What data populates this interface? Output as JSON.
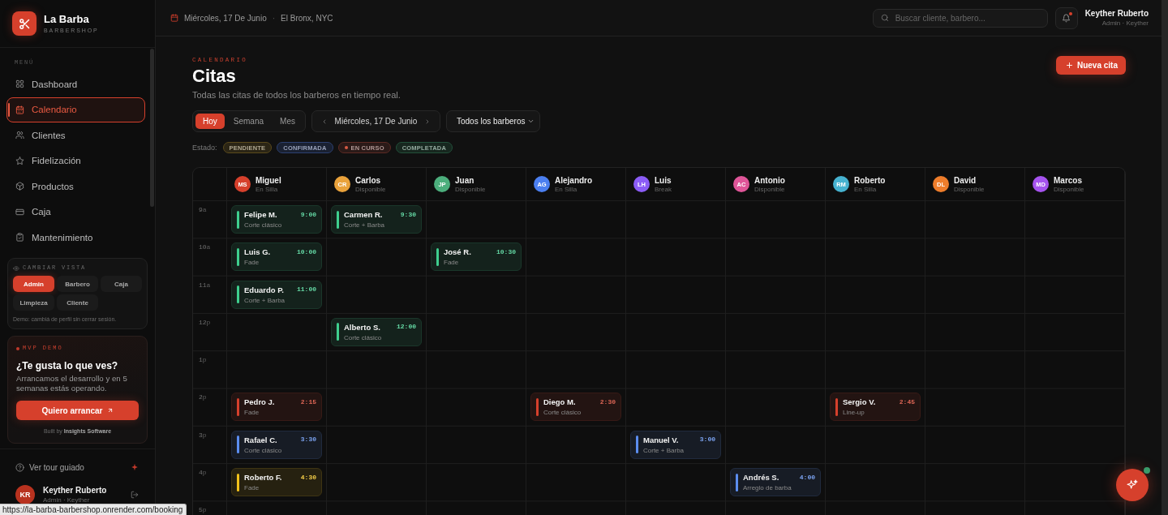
{
  "brand": {
    "name": "La Barba",
    "tagline": "BARBERSHOP"
  },
  "sidebar": {
    "section_label": "MENÚ",
    "items": [
      {
        "label": "Dashboard",
        "selected": false
      },
      {
        "label": "Calendario",
        "selected": true
      },
      {
        "label": "Clientes",
        "selected": false
      },
      {
        "label": "Fidelización",
        "selected": false
      },
      {
        "label": "Productos",
        "selected": false
      },
      {
        "label": "Caja",
        "selected": false
      },
      {
        "label": "Mantenimiento",
        "selected": false
      }
    ]
  },
  "view_switcher": {
    "title": "CAMBIAR VISTA",
    "options": [
      {
        "label": "Admin",
        "selected": true
      },
      {
        "label": "Barbero",
        "selected": false
      },
      {
        "label": "Caja",
        "selected": false
      },
      {
        "label": "Limpieza",
        "selected": false
      },
      {
        "label": "Cliente",
        "selected": false
      }
    ],
    "note": "Demo: cambiá de perfil sin cerrar sesión."
  },
  "promo": {
    "eyebrow": "MVP DEMO",
    "title": "¿Te gusta lo que ves?",
    "text": "Arrancamos el desarrollo y en 5 semanas estás operando.",
    "button": "Quiero arrancar",
    "credit": "Built by **Insights Software**"
  },
  "sidebar_footer": {
    "tour": "Ver tour guiado",
    "user": {
      "initials": "KR",
      "name": "Keyther Ruberto",
      "role": "Admin · Keyther"
    }
  },
  "status_url": "https://la-barba-barbershop.onrender.com/booking",
  "topbar": {
    "date": "Miércoles, 17 De Junio",
    "separator": "·",
    "location": "El Bronx, NYC",
    "search": {
      "placeholder": "Buscar cliente, barbero..."
    },
    "notifications": {
      "unread": true
    },
    "user": {
      "name": "Keyther Ruberto",
      "role": "Admin · Keyther"
    }
  },
  "page": {
    "eyebrow": "CALENDARIO",
    "title": "Citas",
    "subtitle": "Todas las citas de todos los barberos en tiempo real.",
    "new_button": "Nueva cita"
  },
  "controls": {
    "views": [
      {
        "label": "Hoy",
        "selected": true
      },
      {
        "label": "Semana",
        "selected": false
      },
      {
        "label": "Mes",
        "selected": false
      }
    ],
    "date": "Miércoles, 17 De Junio",
    "barber_filter": "Todos los barberos"
  },
  "legend": {
    "label": "Estado:",
    "statuses": [
      {
        "label": "PENDIENTE",
        "color": "#5a4a1c",
        "live": false
      },
      {
        "label": "CONFIRMADA",
        "color": "#2c4070",
        "live": false
      },
      {
        "label": "EN CURSO",
        "color": "#5c2a24",
        "live": true
      },
      {
        "label": "COMPLETADA",
        "color": "#22503a",
        "live": false
      }
    ]
  },
  "schedule": {
    "barbers": [
      {
        "initials": "MS",
        "name": "Miguel",
        "availability": "En Silla",
        "color": "#d6402c"
      },
      {
        "initials": "CR",
        "name": "Carlos",
        "availability": "Disponible",
        "color": "#e9a23b"
      },
      {
        "initials": "JP",
        "name": "Juan",
        "availability": "Disponible",
        "color": "#4cae7c"
      },
      {
        "initials": "AG",
        "name": "Alejandro",
        "availability": "En Silla",
        "color": "#4b7ff0"
      },
      {
        "initials": "LH",
        "name": "Luis",
        "availability": "Break",
        "color": "#8b5cf6"
      },
      {
        "initials": "AC",
        "name": "Antonio",
        "availability": "Disponible",
        "color": "#df5598"
      },
      {
        "initials": "RM",
        "name": "Roberto",
        "availability": "En Silla",
        "color": "#46b2d0"
      },
      {
        "initials": "DL",
        "name": "David",
        "availability": "Disponible",
        "color": "#ee7d2b"
      },
      {
        "initials": "MD",
        "name": "Marcos",
        "availability": "Disponible",
        "color": "#a653ef"
      }
    ],
    "rows": [
      {
        "hour": "9",
        "period": "a",
        "cells": [
          {
            "client": "Felipe M.",
            "time": "9:00",
            "service": "Corte clásico",
            "color": "#3ecf8e"
          },
          {
            "client": "Carmen R.",
            "time": "9:30",
            "service": "Corte + Barba",
            "color": "#3ecf8e"
          },
          null,
          null,
          null,
          null,
          null,
          null,
          null
        ]
      },
      {
        "hour": "10",
        "period": "a",
        "cells": [
          {
            "client": "Luis G.",
            "time": "10:00",
            "service": "Fade",
            "color": "#3ecf8e"
          },
          null,
          {
            "client": "José R.",
            "time": "10:30",
            "service": "Fade",
            "color": "#3ecf8e"
          },
          null,
          null,
          null,
          null,
          null,
          null
        ]
      },
      {
        "hour": "11",
        "period": "a",
        "cells": [
          {
            "client": "Eduardo P.",
            "time": "11:00",
            "service": "Corte + Barba",
            "color": "#3ecf8e"
          },
          null,
          null,
          null,
          null,
          null,
          null,
          null,
          null
        ]
      },
      {
        "hour": "12",
        "period": "p",
        "cells": [
          null,
          {
            "client": "Alberto S.",
            "time": "12:00",
            "service": "Corte clásico",
            "color": "#3ecf8e"
          },
          null,
          null,
          null,
          null,
          null,
          null,
          null
        ]
      },
      {
        "hour": "1",
        "period": "p",
        "cells": [
          null,
          null,
          null,
          null,
          null,
          null,
          null,
          null,
          null
        ]
      },
      {
        "hour": "2",
        "period": "p",
        "cells": [
          {
            "client": "Pedro J.",
            "time": "2:15",
            "service": "Fade",
            "color": "#d6402c"
          },
          null,
          null,
          {
            "client": "Diego M.",
            "time": "2:30",
            "service": "Corte clásico",
            "color": "#d6402c"
          },
          null,
          null,
          {
            "client": "Sergio V.",
            "time": "2:45",
            "service": "Line-up",
            "color": "#d6402c"
          },
          null,
          null
        ]
      },
      {
        "hour": "3",
        "period": "p",
        "cells": [
          {
            "client": "Rafael C.",
            "time": "3:30",
            "service": "Corte clásico",
            "color": "#5b8def"
          },
          null,
          null,
          null,
          {
            "client": "Manuel V.",
            "time": "3:00",
            "service": "Corte + Barba",
            "color": "#5b8def"
          },
          null,
          null,
          null,
          null
        ]
      },
      {
        "hour": "4",
        "period": "p",
        "cells": [
          {
            "client": "Roberto F.",
            "time": "4:30",
            "service": "Fade",
            "color": "#f2c21a"
          },
          null,
          null,
          null,
          null,
          {
            "client": "Andrés S.",
            "time": "4:00",
            "service": "Arreglo de barba",
            "color": "#5b8def"
          },
          null,
          null,
          null
        ]
      },
      {
        "hour": "5",
        "period": "p",
        "cells": [
          null,
          null,
          null,
          null,
          null,
          null,
          null,
          null,
          null
        ]
      }
    ]
  },
  "assistant": {
    "online": true
  }
}
